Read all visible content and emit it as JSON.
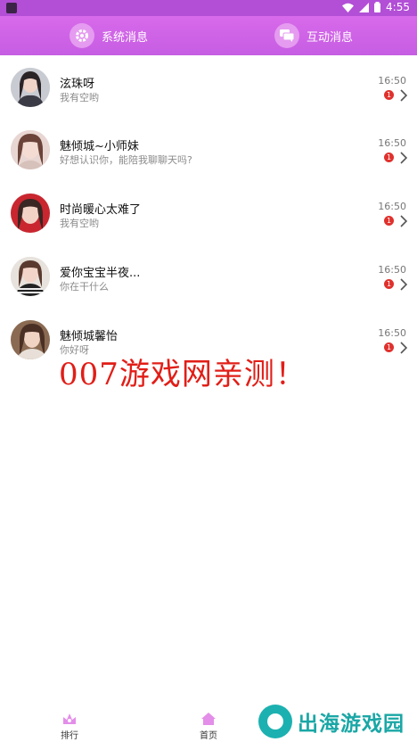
{
  "status_bar": {
    "time": "4:55"
  },
  "header": {
    "tabs": [
      {
        "label": "系统消息"
      },
      {
        "label": "互动消息"
      }
    ]
  },
  "conversations": [
    {
      "name": "泫珠呀",
      "message": "我有空哟",
      "time": "16:50",
      "unread": "1"
    },
    {
      "name": "魅倾城~小师妹",
      "message": "好想认识你，能陪我聊聊天吗?",
      "time": "16:50",
      "unread": "1"
    },
    {
      "name": "时尚暖心太难了",
      "message": "我有空哟",
      "time": "16:50",
      "unread": "1"
    },
    {
      "name": "爱你宝宝半夜...",
      "message": "你在干什么",
      "time": "16:50",
      "unread": "1"
    },
    {
      "name": "魅倾城馨怡",
      "message": "你好呀",
      "time": "16:50",
      "unread": "1"
    }
  ],
  "watermark": "007游戏网亲测！",
  "bottom_nav": [
    {
      "label": "排行"
    },
    {
      "label": "首页"
    }
  ],
  "brand_logo_text": "出海游戏园",
  "colors": {
    "header": "#c65de3",
    "badge": "#e0312d",
    "brand": "#1aa7a6",
    "watermark": "#e11e17"
  }
}
